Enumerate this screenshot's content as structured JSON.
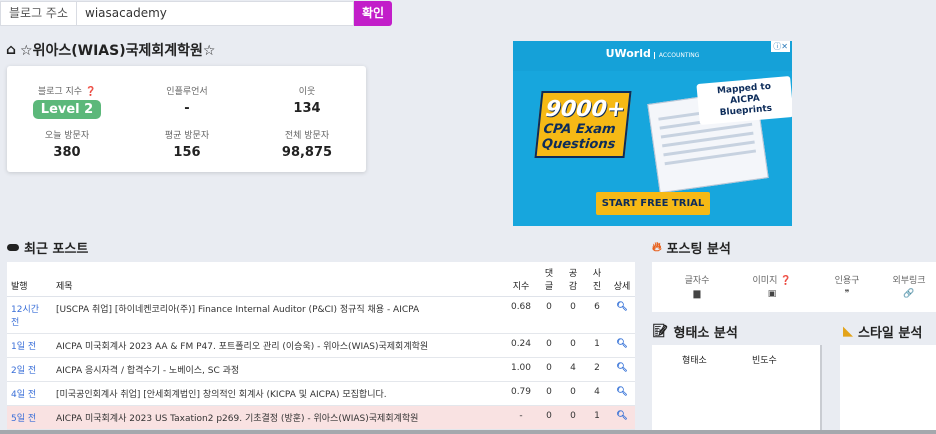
{
  "search": {
    "label": "블로그 주소",
    "value": "wiasacademy",
    "button": "확인"
  },
  "blog": {
    "name": "☆위아스(WIAS)국제회계학원☆",
    "stats": [
      {
        "key": "블로그 지수 ❓",
        "value": "Level 2"
      },
      {
        "key": "인플루언서",
        "value": "-"
      },
      {
        "key": "이웃",
        "value": "134"
      },
      {
        "key": "오늘 방문자",
        "value": "380"
      },
      {
        "key": "평균 방문자",
        "value": "156"
      },
      {
        "key": "전체 방문자",
        "value": "98,875"
      }
    ]
  },
  "ad": {
    "brand": "UWorld",
    "brand_sub": "ACCOUNTING",
    "headline_num": "9000+",
    "headline_text": "CPA Exam Questions",
    "tag": "Mapped to AICPA Blueprints",
    "cta": "START FREE TRIAL"
  },
  "recent": {
    "title": "최근 포스트",
    "headers": {
      "when": "발행",
      "title": "제목",
      "index": "지수",
      "comment": "댓글",
      "like": "공감",
      "photo": "사진",
      "detail": "상세"
    },
    "rows": [
      {
        "when": "12시간 전",
        "title": "[USCPA 취업] [하이네켄코리아(주)] Finance Internal Auditor (P&CI) 정규직 채용 - AICPA",
        "index": "0.68",
        "comment": "0",
        "like": "0",
        "photo": "6"
      },
      {
        "when": "1일 전",
        "title": "AICPA 미국회계사 2023 AA & FM P47. 포트폴리오 관리 (이승욱) - 위아스(WIAS)국제회계학원",
        "index": "0.24",
        "comment": "0",
        "like": "0",
        "photo": "1"
      },
      {
        "when": "2일 전",
        "title": "AICPA 응시자격 / 합격수기 - 노베이스, SC 과정",
        "index": "1.00",
        "comment": "0",
        "like": "4",
        "photo": "2"
      },
      {
        "when": "4일 전",
        "title": "[미국공인회계사 취업] [안세회계법인] 창의적인 회계사 (KICPA 및 AICPA) 모집합니다.",
        "index": "0.79",
        "comment": "0",
        "like": "0",
        "photo": "4"
      },
      {
        "when": "5일 전",
        "title": "AICPA 미국회계사 2023 US Taxation2 p269. 기초결정 (방훈) - 위아스(WIAS)국제회계학원",
        "index": "-",
        "comment": "0",
        "like": "0",
        "photo": "1"
      }
    ]
  },
  "posting": {
    "title": "포스팅 분석",
    "cols": [
      {
        "label": "글자수",
        "icon": "▆"
      },
      {
        "label": "이미지 ❓",
        "icon": "▣"
      },
      {
        "label": "인용구",
        "icon": "❞"
      },
      {
        "label": "외부링크",
        "icon": "🔗"
      }
    ]
  },
  "morph": {
    "title": "형태소 분석",
    "h1": "형태소",
    "h2": "빈도수"
  },
  "style": {
    "title": "스타일 분석"
  }
}
